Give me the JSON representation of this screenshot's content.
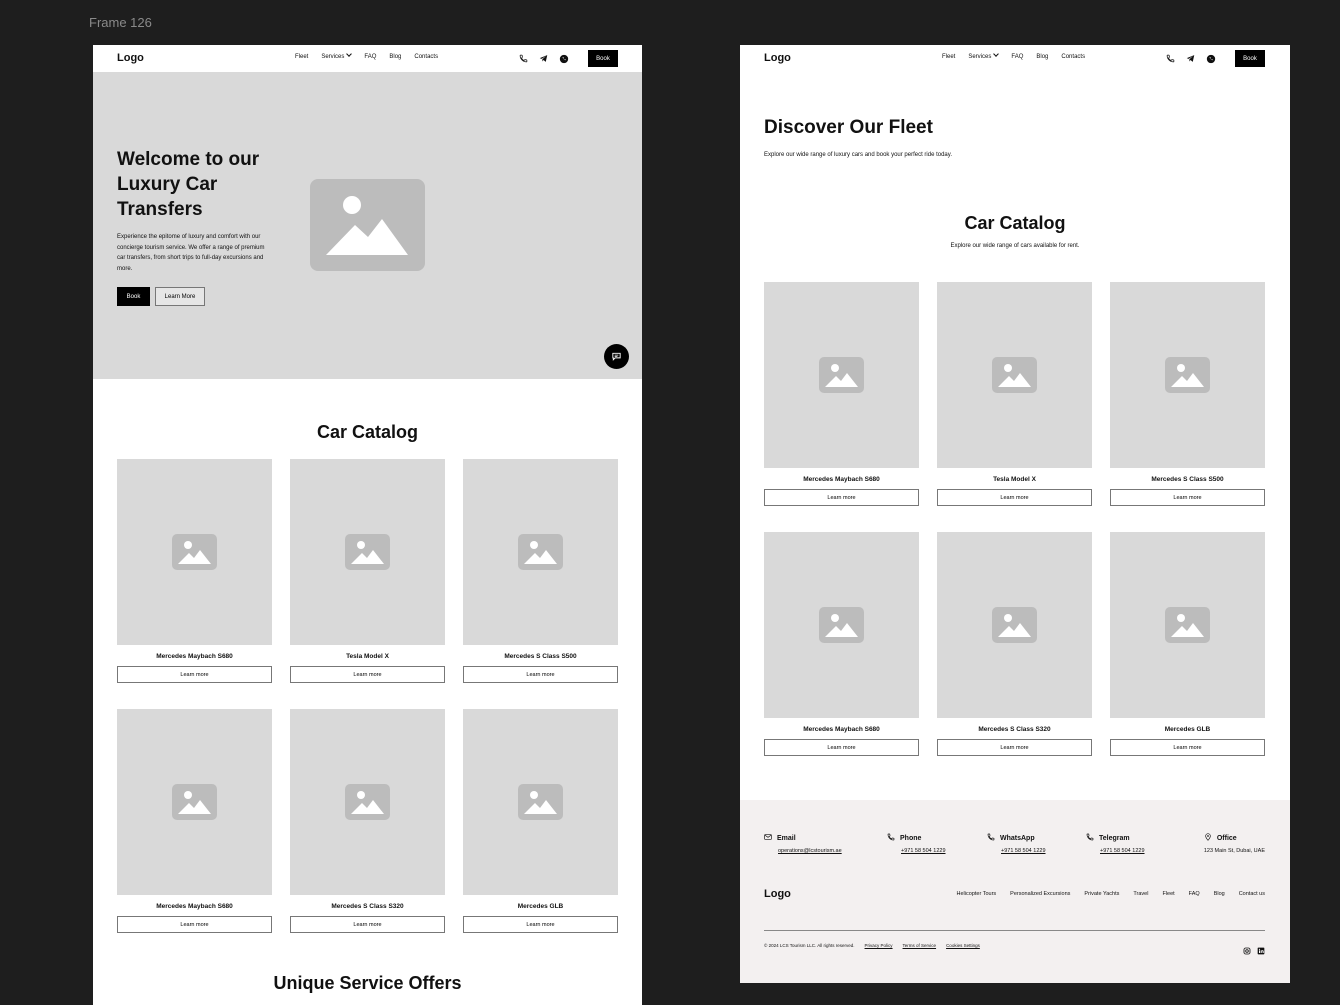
{
  "canvas": {
    "frame_label": "Frame 126"
  },
  "nav": {
    "logo": "Logo",
    "links": [
      "Fleet",
      "Services",
      "FAQ",
      "Blog",
      "Contacts"
    ],
    "book_label": "Book"
  },
  "home": {
    "hero": {
      "title": "Welcome to our Luxury Car Transfers",
      "description": "Experience the epitome of luxury and comfort with our concierge tourism service. We offer a range of premium car transfers, from short trips to full-day excursions and more.",
      "book_label": "Book",
      "learn_label": "Learn More"
    },
    "catalog_title": "Car Catalog",
    "cars": [
      {
        "name": "Mercedes Maybach S680",
        "button": "Learn more"
      },
      {
        "name": "Tesla Model X",
        "button": "Learn more"
      },
      {
        "name": "Mercedes S Class S500",
        "button": "Learn more"
      },
      {
        "name": "Mercedes Maybach S680",
        "button": "Learn more"
      },
      {
        "name": "Mercedes S Class S320",
        "button": "Learn more"
      },
      {
        "name": "Mercedes GLB",
        "button": "Learn more"
      }
    ],
    "offers_title": "Unique Service Offers"
  },
  "fleet": {
    "title": "Discover Our Fleet",
    "intro": "Explore our wide range of luxury cars and book your perfect ride today.",
    "catalog_title": "Car Catalog",
    "catalog_subtitle": "Explore our wide range of cars available for rent.",
    "cars": [
      {
        "name": "Mercedes Maybach S680",
        "button": "Learn more"
      },
      {
        "name": "Tesla Model X",
        "button": "Learn more"
      },
      {
        "name": "Mercedes S Class S500",
        "button": "Learn more"
      },
      {
        "name": "Mercedes Maybach S680",
        "button": "Learn more"
      },
      {
        "name": "Mercedes S Class S320",
        "button": "Learn more"
      },
      {
        "name": "Mercedes GLB",
        "button": "Learn more"
      }
    ]
  },
  "footer": {
    "contacts": [
      {
        "label": "Email",
        "value": "operations@lcstourism.ae",
        "icon": "mail-icon"
      },
      {
        "label": "Phone",
        "value": "+971 58 504 1229",
        "icon": "phone-icon"
      },
      {
        "label": "WhatsApp",
        "value": "+971 58 504 1229",
        "icon": "phone-icon"
      },
      {
        "label": "Telegram",
        "value": "+971 58 504 1229",
        "icon": "phone-icon"
      },
      {
        "label": "Office",
        "value": "123 Main St, Dubai, UAE",
        "icon": "location-icon"
      }
    ],
    "logo": "Logo",
    "links": [
      "Helicopter Tours",
      "Personalized Excursions",
      "Private Yachts",
      "Travel",
      "Fleet",
      "FAQ",
      "Blog",
      "Contact us"
    ],
    "copyright": "© 2024 LCS Tourism LLC. All rights reserved.",
    "privacy": "Privacy Policy",
    "terms": "Terms of Service",
    "cookies": "Cookies Settings"
  }
}
